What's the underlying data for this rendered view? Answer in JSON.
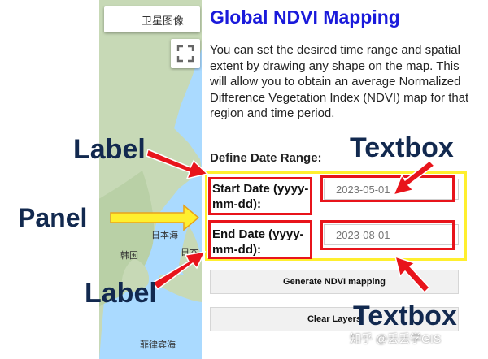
{
  "map": {
    "type_button": "卫星图像",
    "labels": {
      "sea_japan": "日本海",
      "country_korea": "韩国",
      "country_japan": "日本",
      "sea_philippine": "菲律宾海"
    }
  },
  "panel": {
    "title": "Global NDVI Mapping",
    "description": "You can set the desired time range and spatial extent by drawing any shape on the map. This will allow you to obtain an average Normalized Difference Vegetation Index (NDVI) map for that region and time period.",
    "define_date_label": "Define Date Range:",
    "start_date_label": "Start Date (yyyy-mm-dd):",
    "start_date_value": "2023-05-01",
    "end_date_label": "End Date (yyyy-mm-dd):",
    "end_date_value": "2023-08-01",
    "generate_button": "Generate NDVI mapping",
    "clear_button": "Clear Layers"
  },
  "annotations": {
    "label_top": "Label",
    "label_bottom": "Label",
    "panel": "Panel",
    "textbox_top": "Textbox",
    "textbox_bottom": "Textbox",
    "colors": {
      "arrow_red": "#e8141b",
      "highlight_yellow": "#ffef2e",
      "text_navy": "#12294f"
    }
  },
  "watermark": "知乎 @丢丢学GIS"
}
